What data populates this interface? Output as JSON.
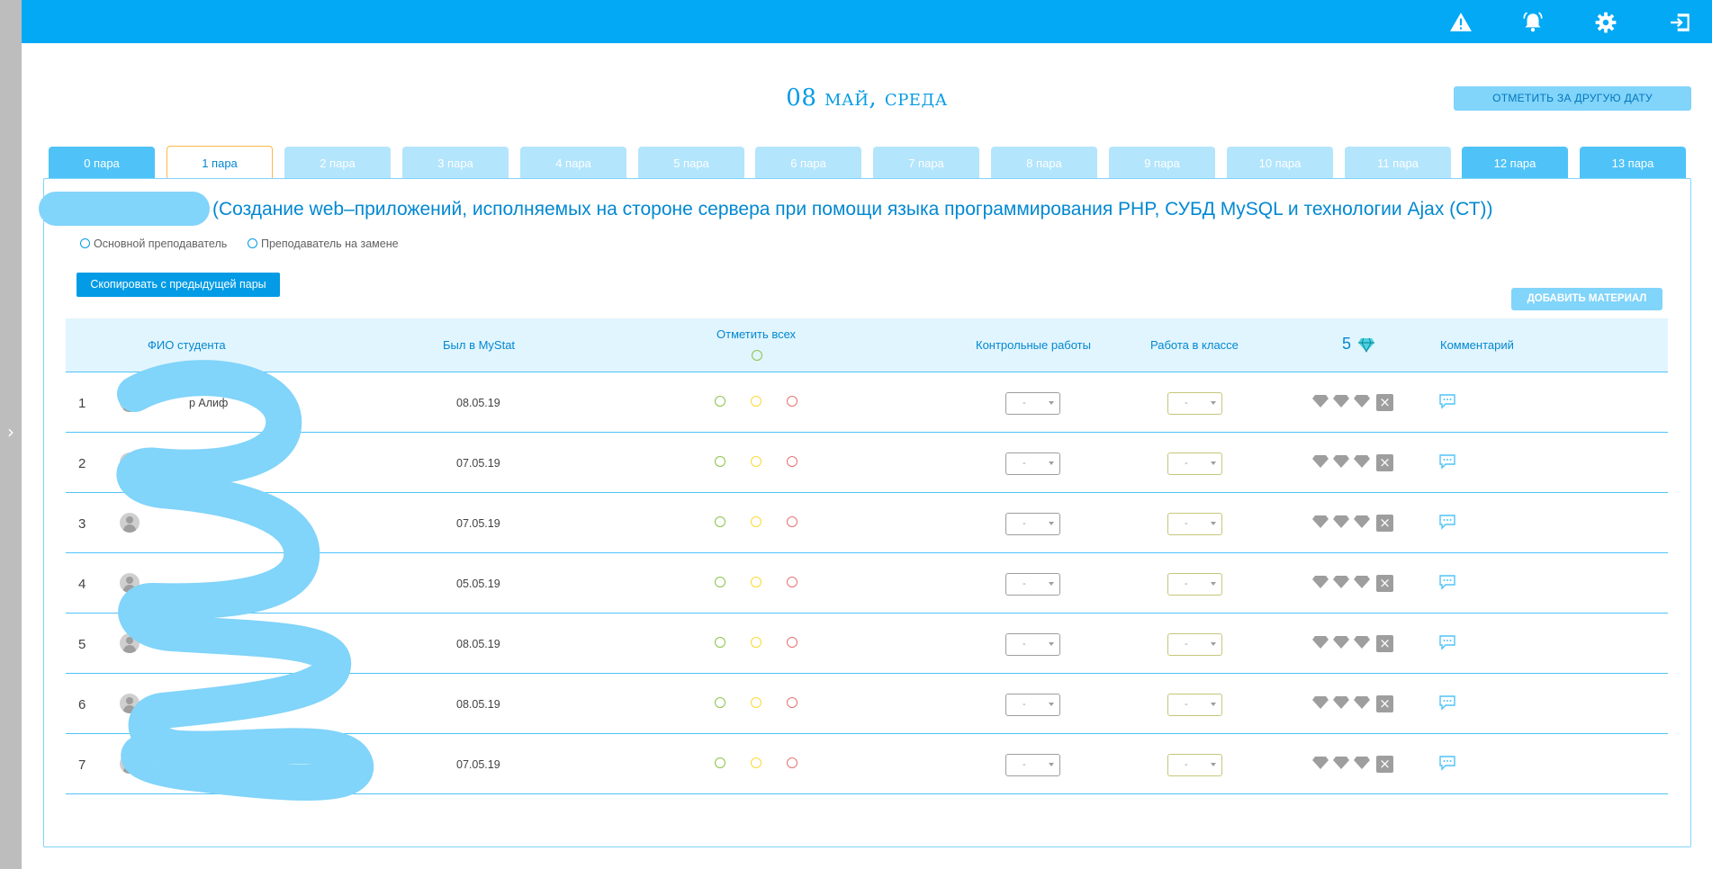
{
  "topbar": {
    "icons": [
      "warning-icon",
      "bell-icon",
      "gear-icon",
      "logout-icon"
    ]
  },
  "header": {
    "date_title": "08 май, среда",
    "other_date_button": "Отметить за другую дату"
  },
  "tabs": [
    {
      "label": "0 пара"
    },
    {
      "label": "1 пара"
    },
    {
      "label": "2 пара"
    },
    {
      "label": "3 пара"
    },
    {
      "label": "4 пара"
    },
    {
      "label": "5 пара"
    },
    {
      "label": "6 пара"
    },
    {
      "label": "7 пара"
    },
    {
      "label": "8 пара"
    },
    {
      "label": "9 пара"
    },
    {
      "label": "10 пара"
    },
    {
      "label": "11 пара"
    },
    {
      "label": "12 пара"
    },
    {
      "label": "13 пара"
    }
  ],
  "active_tab": "1 пара",
  "lesson": {
    "subject": "(Создание web–приложений, исполняемых на стороне сервера при помощи языка программирования PHP, СУБД MySQL и технологии Ajax (СТ))",
    "radio_main": "Основной преподаватель",
    "radio_substitute": "Преподаватель на замене",
    "copy_button": "Скопировать с предыдущей пары",
    "add_material_button": "Добавить материал"
  },
  "table": {
    "headers": {
      "name": "ФИО студента",
      "mystat": "Был в MyStat",
      "mark_all": "Отметить всех",
      "tests": "Контрольные работы",
      "classwork": "Работа в классе",
      "gems_count": "5",
      "comment": "Комментарий"
    },
    "rows": [
      {
        "num": "1",
        "name_fragment": "р Алиф",
        "date": "08.05.19",
        "test": "-",
        "classwork": "-"
      },
      {
        "num": "2",
        "name_fragment": "",
        "date": "07.05.19",
        "test": "-",
        "classwork": "-"
      },
      {
        "num": "3",
        "name_fragment": "",
        "date": "07.05.19",
        "test": "-",
        "classwork": "-"
      },
      {
        "num": "4",
        "name_fragment": "",
        "date": "05.05.19",
        "test": "-",
        "classwork": "-"
      },
      {
        "num": "5",
        "name_fragment": "",
        "date": "08.05.19",
        "test": "-",
        "classwork": "-"
      },
      {
        "num": "6",
        "name_fragment": "",
        "date": "08.05.19",
        "test": "-",
        "classwork": "-"
      },
      {
        "num": "7",
        "name_fragment": "",
        "date": "07.05.19",
        "test": "-",
        "classwork": "-"
      }
    ]
  },
  "colors": {
    "primary": "#03a9f4",
    "accent_dark": "#0288d1",
    "tab_light": "#b3e5fc",
    "redaction": "#81d4fa"
  }
}
